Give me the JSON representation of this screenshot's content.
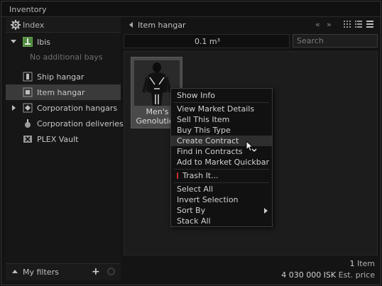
{
  "window": {
    "title": "Inventory"
  },
  "left_panel": {
    "index_label": "Index",
    "ship": {
      "name": "Ibis",
      "no_bays_text": "No additional bays"
    },
    "items": [
      {
        "label": "Ship hangar",
        "icon": "ship-hangar-icon"
      },
      {
        "label": "Item hangar",
        "icon": "item-hangar-icon",
        "selected": true
      },
      {
        "label": "Corporation hangars",
        "icon": "corp-hangar-icon"
      },
      {
        "label": "Corporation deliveries",
        "icon": "corp-deliveries-icon"
      },
      {
        "label": "PLEX Vault",
        "icon": "plex-vault-icon"
      }
    ],
    "filters_label": "My filters"
  },
  "main": {
    "breadcrumb": "Item hangar",
    "volume": "0.1 m³",
    "search_placeholder": "Search",
    "item": {
      "name_line1": "Men's",
      "name_line2": "Genolution"
    },
    "summary": {
      "count": "1",
      "count_unit": "Item",
      "price": "4 030 000 ISK",
      "price_label": "Est. price"
    }
  },
  "context_menu": {
    "items": [
      {
        "label": "Show Info"
      },
      {
        "label": "View Market Details"
      },
      {
        "label": "Sell This Item"
      },
      {
        "label": "Buy This Type"
      },
      {
        "label": "Create Contract",
        "hovered": true
      },
      {
        "label": "Find in Contracts"
      },
      {
        "label": "Add to Market Quickbar"
      },
      {
        "label": "Trash It..."
      },
      {
        "label": "Select All"
      },
      {
        "label": "Invert Selection"
      },
      {
        "label": "Sort By"
      },
      {
        "label": "Stack All"
      }
    ]
  },
  "colors": {
    "selected_row": "#3a3a3a",
    "ship_icon": "#4e8a3e",
    "trash_marker": "#c43030"
  }
}
